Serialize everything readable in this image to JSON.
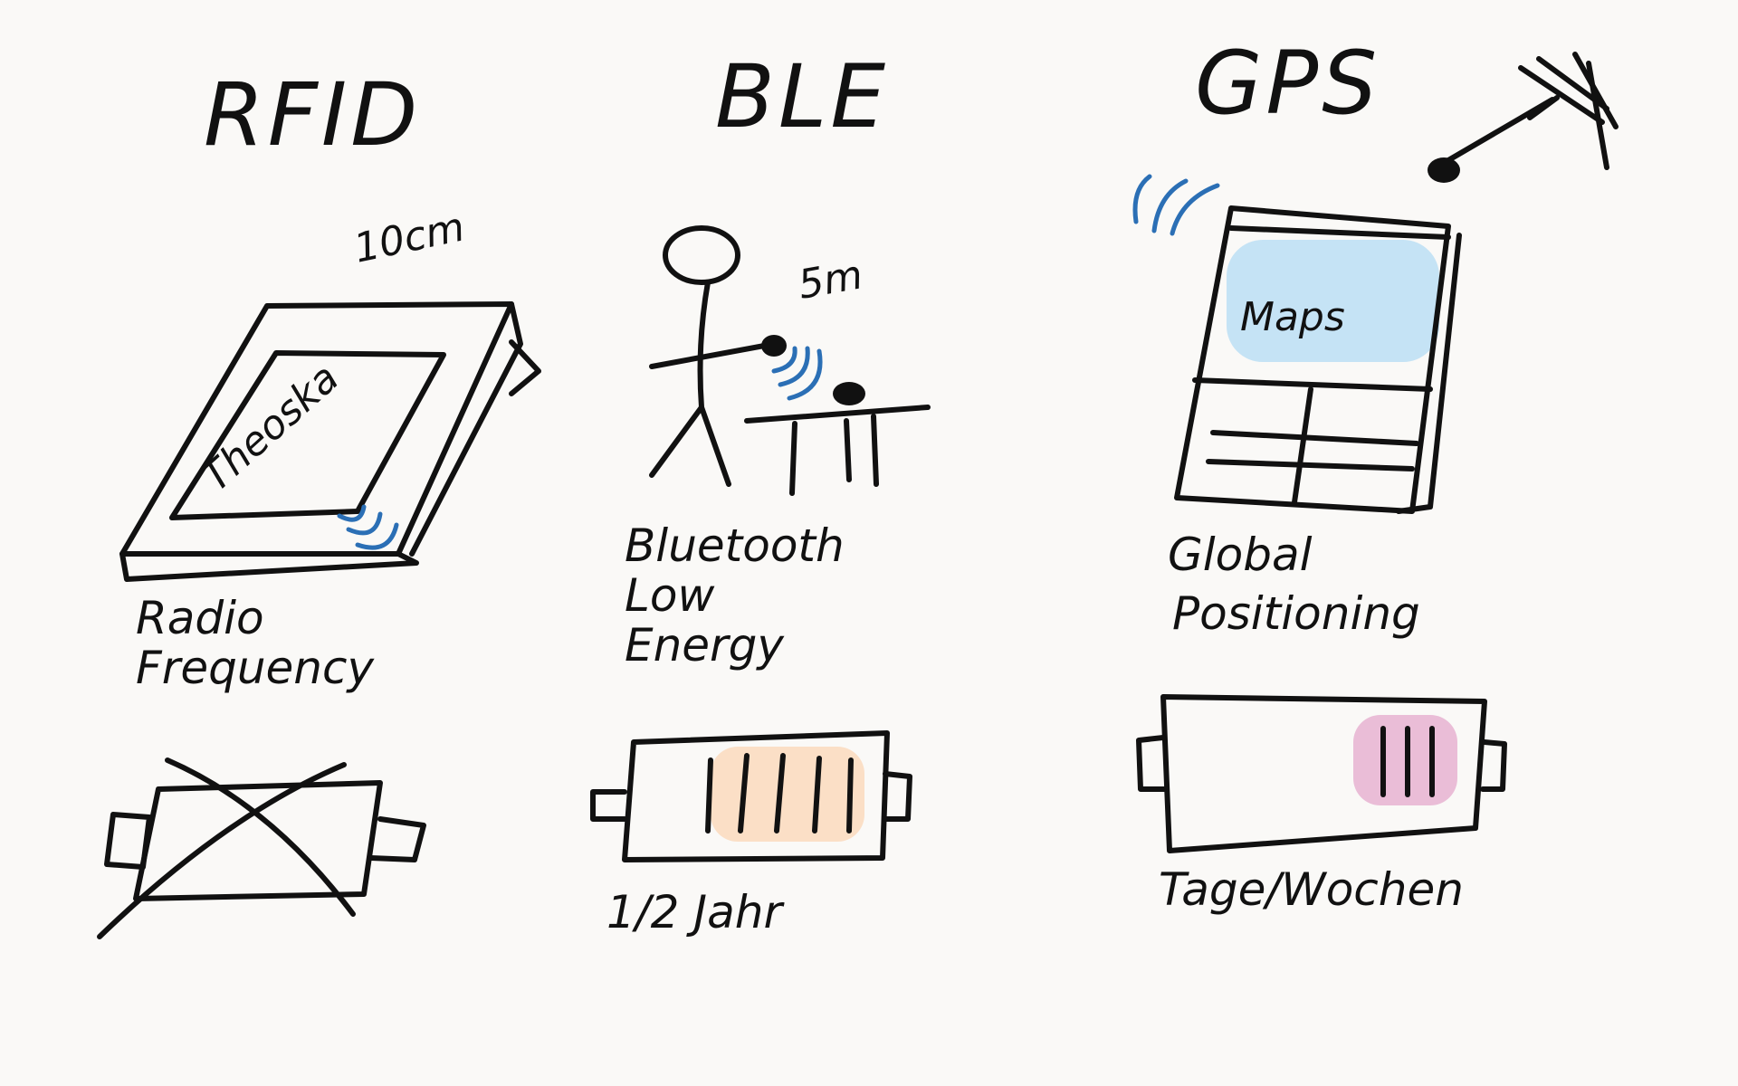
{
  "columns": [
    {
      "id": "rfid",
      "title": "RFID",
      "range": "10cm",
      "device_text": "Theoska",
      "description": [
        "Radio",
        "Frequency"
      ],
      "battery_note": ""
    },
    {
      "id": "ble",
      "title": "BLE",
      "range": "5m",
      "description": [
        "Bluetooth",
        "Low",
        "Energy"
      ],
      "battery_note": "1/2 Jahr"
    },
    {
      "id": "gps",
      "title": "GPS",
      "device_text": "Maps",
      "description": [
        "Global",
        "Positioning"
      ],
      "battery_note": "Tage/Wochen"
    }
  ],
  "colors": {
    "ink": "#111111",
    "signal": "#2b6fb5",
    "maps_highlight": "#bfe0f4",
    "ble_battery_fill": "#fbdcc0",
    "gps_battery_fill": "#e8b6d3"
  }
}
